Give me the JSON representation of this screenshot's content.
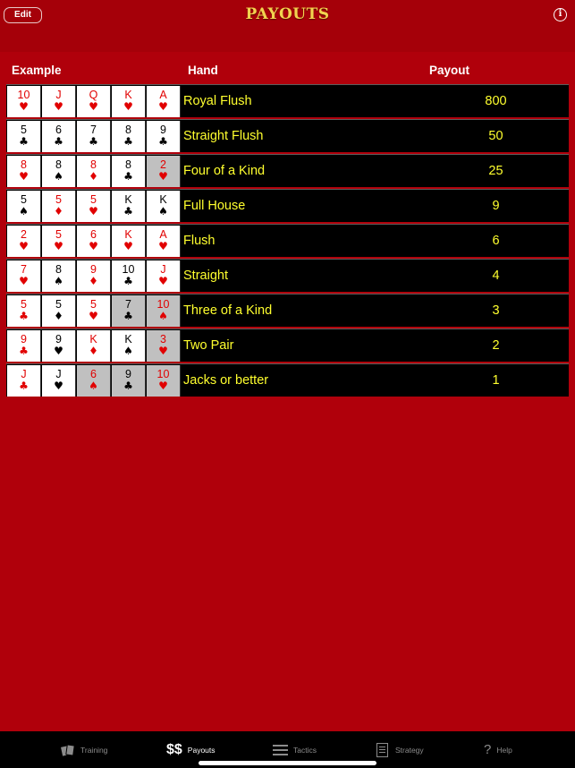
{
  "navbar": {
    "edit_label": "Edit",
    "title": "PAYOUTS",
    "info_icon": "info-icon"
  },
  "table": {
    "headers": {
      "example": "Example",
      "hand": "Hand",
      "payout": "Payout"
    },
    "rows": [
      {
        "hand": "Royal Flush",
        "payout": "800",
        "cards": [
          {
            "rank": "10",
            "suit": "♥",
            "color": "red",
            "held": false
          },
          {
            "rank": "J",
            "suit": "♥",
            "color": "red",
            "held": false
          },
          {
            "rank": "Q",
            "suit": "♥",
            "color": "red",
            "held": false
          },
          {
            "rank": "K",
            "suit": "♥",
            "color": "red",
            "held": false
          },
          {
            "rank": "A",
            "suit": "♥",
            "color": "red",
            "held": false
          }
        ]
      },
      {
        "hand": "Straight Flush",
        "payout": "50",
        "cards": [
          {
            "rank": "5",
            "suit": "♣",
            "color": "black",
            "held": false
          },
          {
            "rank": "6",
            "suit": "♣",
            "color": "black",
            "held": false
          },
          {
            "rank": "7",
            "suit": "♣",
            "color": "black",
            "held": false
          },
          {
            "rank": "8",
            "suit": "♣",
            "color": "black",
            "held": false
          },
          {
            "rank": "9",
            "suit": "♣",
            "color": "black",
            "held": false
          }
        ]
      },
      {
        "hand": "Four of a Kind",
        "payout": "25",
        "cards": [
          {
            "rank": "8",
            "suit": "♥",
            "color": "red",
            "held": false
          },
          {
            "rank": "8",
            "suit": "♠",
            "color": "black",
            "held": false
          },
          {
            "rank": "8",
            "suit": "♦",
            "color": "red",
            "held": false
          },
          {
            "rank": "8",
            "suit": "♣",
            "color": "black",
            "held": false
          },
          {
            "rank": "2",
            "suit": "♥",
            "color": "red",
            "held": true
          }
        ]
      },
      {
        "hand": "Full House",
        "payout": "9",
        "cards": [
          {
            "rank": "5",
            "suit": "♠",
            "color": "black",
            "held": false
          },
          {
            "rank": "5",
            "suit": "♦",
            "color": "red",
            "held": false
          },
          {
            "rank": "5",
            "suit": "♥",
            "color": "red",
            "held": false
          },
          {
            "rank": "K",
            "suit": "♣",
            "color": "black",
            "held": false
          },
          {
            "rank": "K",
            "suit": "♠",
            "color": "black",
            "held": false
          }
        ]
      },
      {
        "hand": "Flush",
        "payout": "6",
        "cards": [
          {
            "rank": "2",
            "suit": "♥",
            "color": "red",
            "held": false
          },
          {
            "rank": "5",
            "suit": "♥",
            "color": "red",
            "held": false
          },
          {
            "rank": "6",
            "suit": "♥",
            "color": "red",
            "held": false
          },
          {
            "rank": "K",
            "suit": "♥",
            "color": "red",
            "held": false
          },
          {
            "rank": "A",
            "suit": "♥",
            "color": "red",
            "held": false
          }
        ]
      },
      {
        "hand": "Straight",
        "payout": "4",
        "cards": [
          {
            "rank": "7",
            "suit": "♥",
            "color": "red",
            "held": false
          },
          {
            "rank": "8",
            "suit": "♠",
            "color": "black",
            "held": false
          },
          {
            "rank": "9",
            "suit": "♦",
            "color": "red",
            "held": false
          },
          {
            "rank": "10",
            "suit": "♣",
            "color": "black",
            "held": false
          },
          {
            "rank": "J",
            "suit": "♥",
            "color": "red",
            "held": false
          }
        ]
      },
      {
        "hand": "Three of a Kind",
        "payout": "3",
        "cards": [
          {
            "rank": "5",
            "suit": "♣",
            "color": "red",
            "held": false
          },
          {
            "rank": "5",
            "suit": "♦",
            "color": "black",
            "held": false
          },
          {
            "rank": "5",
            "suit": "♥",
            "color": "red",
            "held": false
          },
          {
            "rank": "7",
            "suit": "♣",
            "color": "black",
            "held": true
          },
          {
            "rank": "10",
            "suit": "♠",
            "color": "red",
            "held": true
          }
        ]
      },
      {
        "hand": "Two Pair",
        "payout": "2",
        "cards": [
          {
            "rank": "9",
            "suit": "♣",
            "color": "red",
            "held": false
          },
          {
            "rank": "9",
            "suit": "♥",
            "color": "black",
            "held": false
          },
          {
            "rank": "K",
            "suit": "♦",
            "color": "red",
            "held": false
          },
          {
            "rank": "K",
            "suit": "♠",
            "color": "black",
            "held": false
          },
          {
            "rank": "3",
            "suit": "♥",
            "color": "red",
            "held": true
          }
        ]
      },
      {
        "hand": "Jacks or better",
        "payout": "1",
        "cards": [
          {
            "rank": "J",
            "suit": "♣",
            "color": "red",
            "held": false
          },
          {
            "rank": "J",
            "suit": "♥",
            "color": "black",
            "held": false
          },
          {
            "rank": "6",
            "suit": "♠",
            "color": "red",
            "held": true
          },
          {
            "rank": "9",
            "suit": "♣",
            "color": "black",
            "held": true
          },
          {
            "rank": "10",
            "suit": "♥",
            "color": "red",
            "held": true
          }
        ]
      }
    ]
  },
  "tabbar": {
    "tabs": [
      {
        "label": "Training",
        "icon": "cards-icon",
        "active": false
      },
      {
        "label": "Payouts",
        "icon": "dollar-icon",
        "icon_text": "$$",
        "active": true
      },
      {
        "label": "Tactics",
        "icon": "list-icon",
        "active": false
      },
      {
        "label": "Strategy",
        "icon": "document-icon",
        "active": false
      },
      {
        "label": "Help",
        "icon": "question-icon",
        "icon_text": "?",
        "active": false
      }
    ]
  },
  "colors": {
    "background": "#a50009",
    "accent_text": "#ffff2e",
    "title": "#f2d34f",
    "card_red": "#e10000",
    "held_card": "#c0c0c0"
  }
}
